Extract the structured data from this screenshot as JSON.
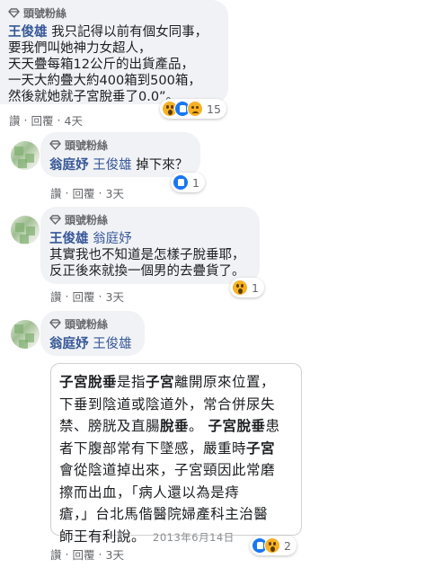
{
  "c1": {
    "badge": "頭號粉絲",
    "author": "王俊雄",
    "lines": [
      "我只記得以前有個女同事，",
      "要我們叫她神力女超人，",
      "天天疊每箱12公斤的出貨產品，",
      "一天大約疊大約400箱到500箱，",
      "然後就她就子宮脫垂了0.0”。"
    ],
    "actions": {
      "like": "讚",
      "reply": "回覆",
      "time": "4天"
    },
    "reactions": {
      "count": "15"
    }
  },
  "c2": {
    "badge": "頭號粉絲",
    "author": "翁庭妤",
    "mention": "王俊雄",
    "text": "掉下來？",
    "actions": {
      "like": "讚",
      "reply": "回覆",
      "time": "3天"
    },
    "reactions": {
      "count": "1"
    }
  },
  "c3": {
    "badge": "頭號粉絲",
    "author": "王俊雄",
    "mention": "翁庭妤",
    "lines": [
      "其實我也不知道是怎樣子脫垂耶，",
      "反正後來就換一個男的去疊貨了。"
    ],
    "actions": {
      "like": "讚",
      "reply": "回覆",
      "time": "3天"
    },
    "reactions": {
      "count": "1"
    }
  },
  "c4": {
    "badge": "頭號粉絲",
    "author": "翁庭妤",
    "mention": "王俊雄",
    "quote": {
      "lines": [
        [
          {
            "t": "子宮脫垂",
            "b": true
          },
          {
            "t": "是指"
          },
          {
            "t": "子宮",
            "b": true
          },
          {
            "t": "離開原來位置，"
          }
        ],
        [
          {
            "t": "下垂到陰道或陰道外，常合併尿失"
          }
        ],
        [
          {
            "t": "禁、膀胱及直腸"
          },
          {
            "t": "脫垂",
            "b": true
          },
          {
            "t": "。 "
          },
          {
            "t": "子宮脫垂",
            "b": true
          },
          {
            "t": "患"
          }
        ],
        [
          {
            "t": "者下腹部常有下墜感，嚴重時"
          },
          {
            "t": "子宮",
            "b": true
          }
        ],
        [
          {
            "t": "會從陰道掉出來，子宮頸因此常磨"
          }
        ],
        [
          {
            "t": "擦而出血，「病人還以為是痔"
          }
        ],
        [
          {
            "t": "瘡，」台北馬偕醫院婦產科主治醫"
          }
        ],
        [
          {
            "t": "師王有利說。"
          }
        ]
      ],
      "date": "2013年6月14日"
    },
    "actions": {
      "like": "讚",
      "reply": "回覆",
      "time": "3天"
    },
    "reactions": {
      "count": "2"
    }
  }
}
